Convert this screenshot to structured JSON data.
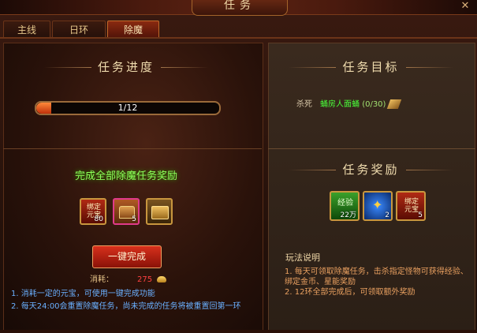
{
  "window": {
    "title": "任务",
    "close_label": "✕"
  },
  "tabs": [
    {
      "label": "主线",
      "active": false
    },
    {
      "label": "日环",
      "active": false
    },
    {
      "label": "除魔",
      "active": true
    }
  ],
  "progress_section": {
    "title": "任务进度",
    "progress_text": "1/12",
    "progress_fraction": 0.0833
  },
  "reward_section": {
    "title": "完成全部除魔任务奖励",
    "items": [
      {
        "label": "绑定\n元宝",
        "count": "80",
        "icon": "bound-ingot-icon"
      },
      {
        "label": "",
        "count": "5",
        "icon": "treasure-chest-icon"
      },
      {
        "label": "",
        "count": "",
        "icon": "golden-book-icon"
      }
    ],
    "button_label": "一键完成",
    "cost_label": "消耗：",
    "cost_value": "275",
    "notes": [
      "1.  消耗一定的元宝，可使用一键完成功能",
      "2.  每天24:00会重置除魔任务，尚未完成的任务将被重置回第一环"
    ]
  },
  "target_section": {
    "title": "任务目标",
    "kill_label": "杀死",
    "monster": "蛹房人面蛹",
    "progress": "(0/30)"
  },
  "task_reward_section": {
    "title": "任务奖励",
    "items": [
      {
        "label": "经验",
        "count": "22万",
        "icon": "experience-icon"
      },
      {
        "label": "",
        "count": "2",
        "icon": "star-soul-icon"
      },
      {
        "label": "绑定\n元宝",
        "count": "5",
        "icon": "bound-ingot-icon"
      }
    ]
  },
  "rules_section": {
    "title": "玩法说明",
    "lines": [
      "1.  每天可领取除魔任务，击杀指定怪物可获得经验、绑定金币、星能奖励",
      "2.  12环全部完成后，可领取额外奖励"
    ]
  },
  "colors": {
    "accent": "#c8963e",
    "progress_fill": "#e0501c",
    "green_text": "#8cff5a",
    "note_blue": "#6ab0ff"
  }
}
